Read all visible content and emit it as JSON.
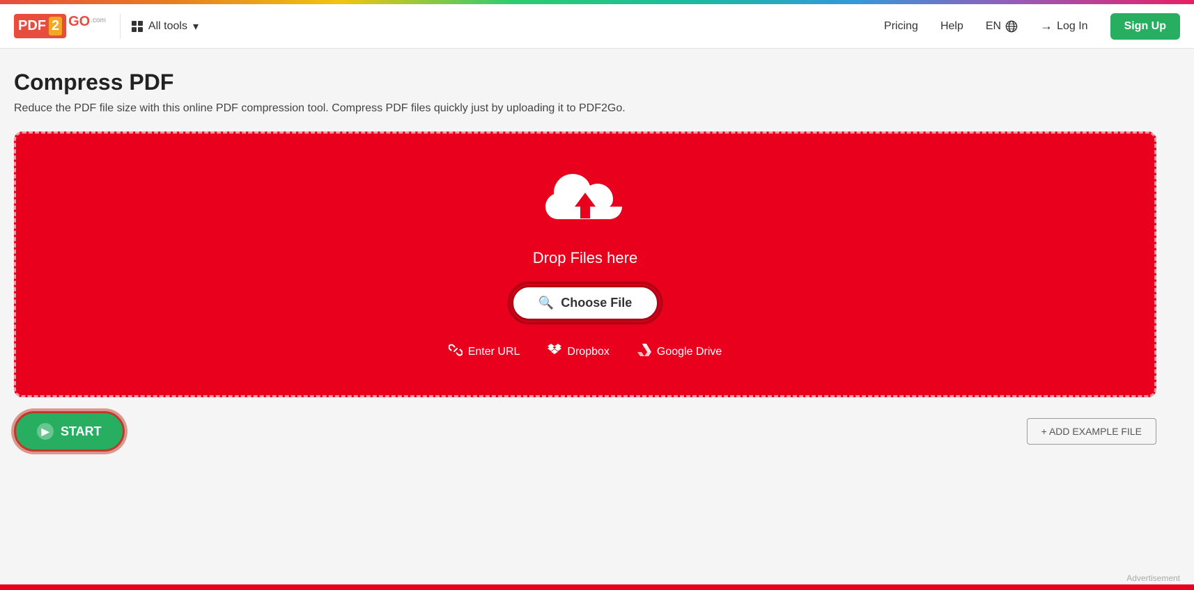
{
  "navbar": {
    "logo": {
      "pdf": "PDF",
      "two": "2",
      "go": "GO",
      "com": ".com"
    },
    "all_tools_label": "All tools",
    "chevron": "▾",
    "pricing_label": "Pricing",
    "help_label": "Help",
    "language_label": "EN",
    "login_label": "Log In",
    "signup_label": "Sign Up"
  },
  "page": {
    "title": "Compress PDF",
    "description": "Reduce the PDF file size with this online PDF compression tool. Compress PDF files quickly just by uploading it to PDF2Go."
  },
  "dropzone": {
    "drop_text": "Drop Files here",
    "choose_file_label": "Choose File",
    "enter_url_label": "Enter URL",
    "dropbox_label": "Dropbox",
    "google_drive_label": "Google Drive"
  },
  "toolbar": {
    "start_label": "START",
    "add_example_label": "+ ADD EXAMPLE FILE"
  },
  "footer": {
    "advertisement": "Advertisement"
  }
}
